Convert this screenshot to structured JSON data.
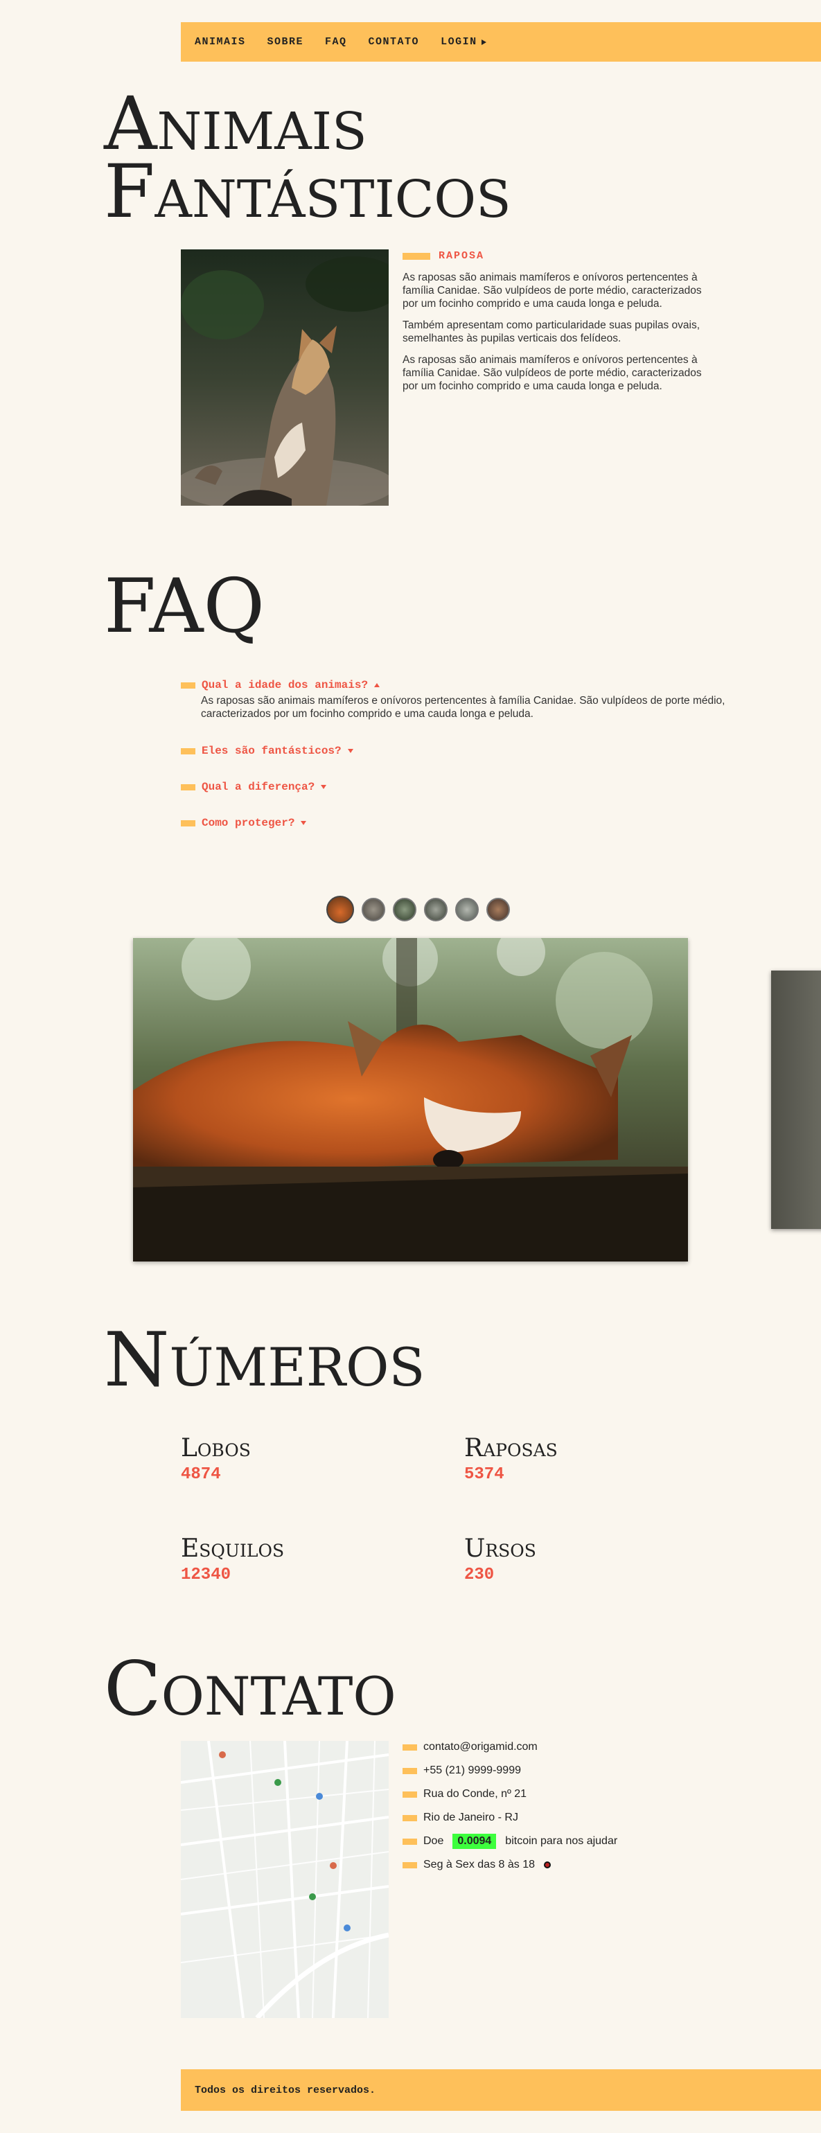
{
  "nav": {
    "items": [
      "ANIMAIS",
      "SOBRE",
      "FAQ",
      "CONTATO",
      "LOGIN"
    ]
  },
  "animais": {
    "title_line1": "Animais",
    "title_line2": "Fantásticos",
    "label": "RAPOSA",
    "paragraphs": [
      "As raposas são animais mamíferos e onívoros pertencentes à família Canidae. São vulpídeos de porte médio, caracterizados por um focinho comprido e uma cauda longa e peluda.",
      "Também apresentam como particularidade suas pupilas ovais, semelhantes às pupilas verticais dos felídeos.",
      "As raposas são animais mamíferos e onívoros pertencentes à família Canidae. São vulpídeos de porte médio, caracterizados por um focinho comprido e uma cauda longa e peluda."
    ]
  },
  "faq": {
    "title": "FAQ",
    "items": [
      {
        "q": "Qual a idade dos animais?",
        "a": "As raposas são animais mamíferos e onívoros pertencentes à família Canidae. São vulpídeos de porte médio, caracterizados por um focinho comprido e uma cauda longa e peluda."
      },
      {
        "q": "Eles são fantásticos?"
      },
      {
        "q": "Qual a diferença?"
      },
      {
        "q": "Como proteger?"
      }
    ]
  },
  "numeros": {
    "title": "Números",
    "stats": [
      {
        "name": "Lobos",
        "value": "4874"
      },
      {
        "name": "Raposas",
        "value": "5374"
      },
      {
        "name": "Esquilos",
        "value": "12340"
      },
      {
        "name": "Ursos",
        "value": "230"
      }
    ]
  },
  "contato": {
    "title": "Contato",
    "email": "contato@origamid.com",
    "phone": "+55 (21) 9999-9999",
    "address": "Rua do Conde, nº 21",
    "city": "Rio de Janeiro - RJ",
    "donate_prefix": "Doe",
    "donate_amount": "0.0094",
    "donate_suffix": "bitcoin para nos ajudar",
    "hours": "Seg à Sex das 8 às 18"
  },
  "footer": {
    "text": "Todos os direitos reservados."
  },
  "colors": {
    "accent": "#fec05a",
    "red": "#e54",
    "background": "#faf6ee",
    "bitcoin_highlight": "#3dff3d"
  }
}
